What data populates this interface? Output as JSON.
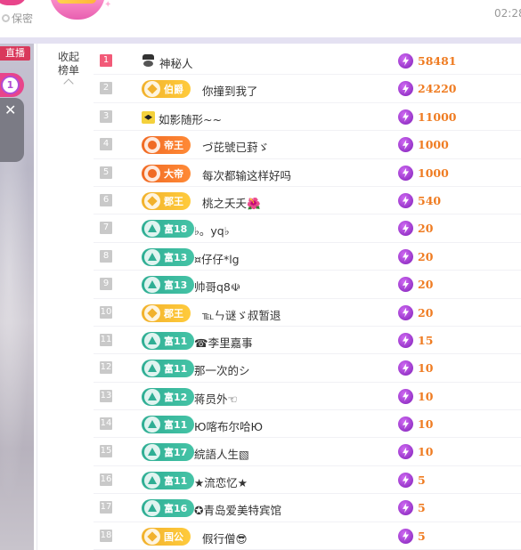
{
  "top": {
    "privacy_label": "保密",
    "time": "02:28",
    "sparkle": "✦"
  },
  "sidebar": {
    "live_tag": "直播",
    "rank_number": "1",
    "close_glyph": "✕"
  },
  "panel": {
    "collapse_line1": "收起",
    "collapse_line2": "榜单"
  },
  "leaderboard": [
    {
      "rank": "1",
      "badge": "",
      "badge_style": "incognito",
      "name": "神秘人",
      "value": "58481"
    },
    {
      "rank": "2",
      "badge": "伯爵",
      "badge_style": "gold",
      "name": "你撞到我了",
      "value": "24220"
    },
    {
      "rank": "3",
      "badge": "",
      "badge_style": "avatar",
      "name": "如影随形~~",
      "value": "11000"
    },
    {
      "rank": "4",
      "badge": "帝王",
      "badge_style": "orange",
      "name": "づ芘號已葑ゞ",
      "value": "1000"
    },
    {
      "rank": "5",
      "badge": "大帝",
      "badge_style": "orange",
      "name": "每次都输这样好吗",
      "value": "1000"
    },
    {
      "rank": "6",
      "badge": "郡王",
      "badge_style": "gold",
      "name": "桃之夭夭🌺",
      "value": "540"
    },
    {
      "rank": "7",
      "badge": "富18",
      "badge_style": "teal",
      "name": "♭。yq♭",
      "value": "20"
    },
    {
      "rank": "8",
      "badge": "富13",
      "badge_style": "teal",
      "name": "¤仔仔*lg",
      "value": "20"
    },
    {
      "rank": "9",
      "badge": "富13",
      "badge_style": "teal",
      "name": "帅哥q8☫",
      "value": "20"
    },
    {
      "rank": "10",
      "badge": "郡王",
      "badge_style": "gold",
      "name": "℡ㄣ谜ゞ叔暂退",
      "value": "20"
    },
    {
      "rank": "11",
      "badge": "富11",
      "badge_style": "teal",
      "name": "☎李里嘉事",
      "value": "15"
    },
    {
      "rank": "12",
      "badge": "富11",
      "badge_style": "teal",
      "name": "那一次的シ",
      "value": "10"
    },
    {
      "rank": "13",
      "badge": "富12",
      "badge_style": "teal",
      "name": "蒋员外☜",
      "value": "10"
    },
    {
      "rank": "14",
      "badge": "富11",
      "badge_style": "teal",
      "name": "Ю喀布尔哈Ю",
      "value": "10"
    },
    {
      "rank": "15",
      "badge": "富17",
      "badge_style": "teal",
      "name": "綄語人生▧",
      "value": "10"
    },
    {
      "rank": "16",
      "badge": "富11",
      "badge_style": "teal",
      "name": "★流恋忆★",
      "value": "5"
    },
    {
      "rank": "17",
      "badge": "富16",
      "badge_style": "teal",
      "name": "✪青岛爱美特宾馆",
      "value": "5"
    },
    {
      "rank": "18",
      "badge": "国公",
      "badge_style": "gold",
      "name": "假行僧😎",
      "value": "5"
    }
  ]
}
